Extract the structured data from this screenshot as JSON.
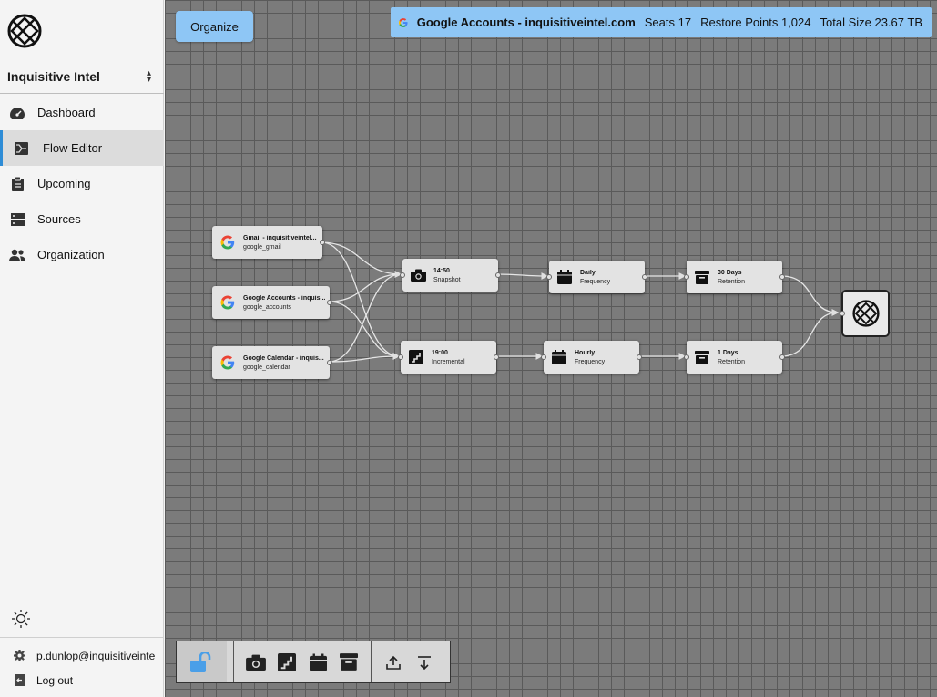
{
  "sidebar": {
    "org_name": "Inquisitive Intel",
    "nav": [
      {
        "label": "Dashboard",
        "icon": "dashboard-icon"
      },
      {
        "label": "Flow Editor",
        "icon": "flow-editor-icon"
      },
      {
        "label": "Upcoming",
        "icon": "clipboard-icon"
      },
      {
        "label": "Sources",
        "icon": "server-icon"
      },
      {
        "label": "Organization",
        "icon": "users-icon"
      }
    ],
    "active_index": 1,
    "user_email": "p.dunlop@inquisitiveinte",
    "logout_label": "Log out"
  },
  "toolbar_top": {
    "organize_label": "Organize"
  },
  "info_bar": {
    "title": "Google Accounts - inquisitiveintel.com",
    "seats": "Seats 17",
    "restore_points": "Restore Points 1,024",
    "total_size": "Total Size 23.67 TB"
  },
  "nodes": {
    "src_gmail": {
      "title": "Gmail - inquisitiveintel...",
      "sub": "google_gmail"
    },
    "src_accounts": {
      "title": "Google Accounts - inquis...",
      "sub": "google_accounts"
    },
    "src_calendar": {
      "title": "Google Calendar - inquis...",
      "sub": "google_calendar"
    },
    "snapshot": {
      "title": "14:50",
      "sub": "Snapshot"
    },
    "incremental": {
      "title": "19:00",
      "sub": "Incremental"
    },
    "daily": {
      "title": "Daily",
      "sub": "Frequency"
    },
    "hourly": {
      "title": "Hourly",
      "sub": "Frequency"
    },
    "ret30": {
      "title": "30 Days",
      "sub": "Retention"
    },
    "ret1": {
      "title": "1 Days",
      "sub": "Retention"
    }
  },
  "colors": {
    "accent": "#8ec6f5",
    "active_border": "#2e8cd6",
    "canvas": "#7b7b7b",
    "grid": "#5a5a5a",
    "node_bg": "#e3e3e3"
  }
}
